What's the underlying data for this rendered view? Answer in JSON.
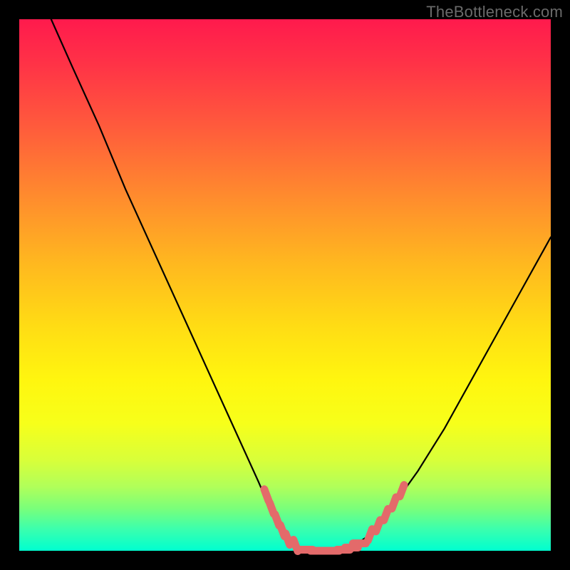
{
  "watermark": "TheBottleneck.com",
  "chart_data": {
    "type": "line",
    "title": "",
    "xlabel": "",
    "ylabel": "",
    "xlim": [
      0,
      100
    ],
    "ylim": [
      0,
      100
    ],
    "series": [
      {
        "name": "bottleneck-curve",
        "x": [
          6,
          10,
          15,
          20,
          25,
          30,
          35,
          40,
          45,
          48,
          52,
          55,
          58,
          60,
          63,
          66,
          70,
          75,
          80,
          85,
          90,
          95,
          100
        ],
        "y": [
          100,
          91,
          80,
          68,
          57,
          46,
          35,
          24,
          13,
          6,
          1,
          0,
          0,
          0,
          1,
          3,
          8,
          15,
          23,
          32,
          41,
          50,
          59
        ]
      }
    ],
    "markers": {
      "name": "highlight-dots",
      "color": "#e36a6a",
      "points": [
        {
          "x": 46.5,
          "y": 10.5
        },
        {
          "x": 47.5,
          "y": 8.0
        },
        {
          "x": 48.5,
          "y": 5.8
        },
        {
          "x": 49.5,
          "y": 3.8
        },
        {
          "x": 50.5,
          "y": 2.2
        },
        {
          "x": 52.0,
          "y": 1.0
        },
        {
          "x": 54.0,
          "y": 0.2
        },
        {
          "x": 56.0,
          "y": 0.0
        },
        {
          "x": 57.5,
          "y": 0.0
        },
        {
          "x": 59.0,
          "y": 0.0
        },
        {
          "x": 61.0,
          "y": 0.2
        },
        {
          "x": 62.5,
          "y": 0.6
        },
        {
          "x": 64.0,
          "y": 1.4
        },
        {
          "x": 66.0,
          "y": 3.0
        },
        {
          "x": 67.5,
          "y": 4.7
        },
        {
          "x": 69.0,
          "y": 6.8
        },
        {
          "x": 70.5,
          "y": 9.0
        },
        {
          "x": 72.0,
          "y": 11.3
        }
      ]
    }
  }
}
